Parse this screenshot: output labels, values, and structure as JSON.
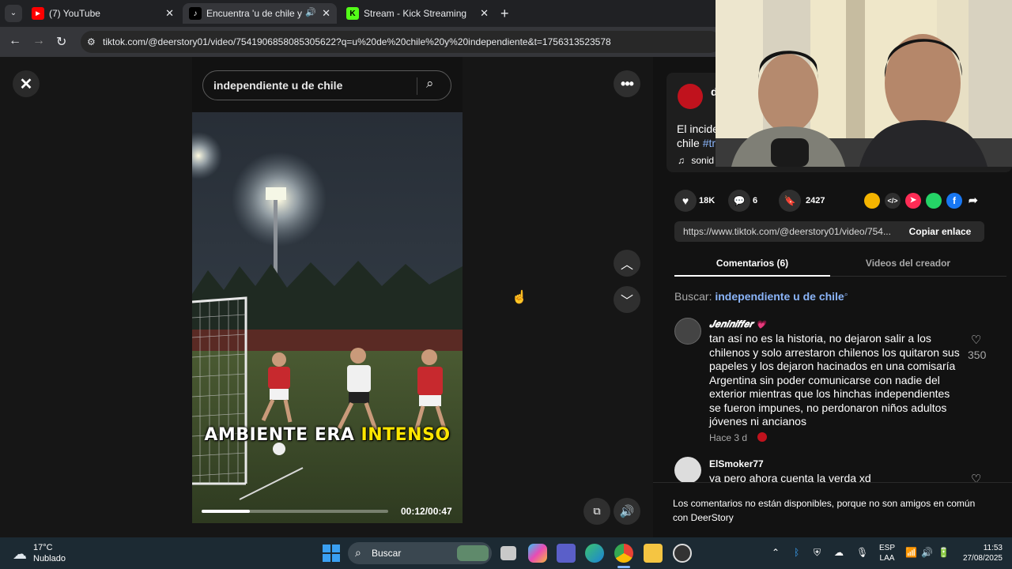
{
  "tabs": [
    {
      "label": "(7) YouTube",
      "icon": "youtube-icon",
      "active": false
    },
    {
      "label": "Encuentra 'u de chile y inde",
      "icon": "tiktok-icon",
      "active": true
    },
    {
      "label": "Stream - Kick Streaming",
      "icon": "kick-icon",
      "active": false
    }
  ],
  "address": {
    "url": "tiktok.com/@deerstory01/video/7541906858085305622?q=u%20de%20chile%20y%20independiente&t=1756313523578"
  },
  "search": {
    "value": "independiente u de chile"
  },
  "video": {
    "caption_white": "AMBIENTE ERA ",
    "caption_yellow": "INTENSO",
    "time": "00:12/00:47",
    "progress": 0.26
  },
  "post": {
    "author_initial": "d",
    "desc_line1": "El incide",
    "desc_line2_a": "chile ",
    "desc_line2_b": "#tr",
    "sound": "sonid"
  },
  "actions": {
    "likes": "18K",
    "comments": "6",
    "saves": "2427"
  },
  "share": {
    "link": "https://www.tiktok.com/@deerstory01/video/754...",
    "copy_label": "Copiar enlace"
  },
  "panel_tabs": {
    "comments": "Comentarios (6)",
    "creator": "Videos del creador"
  },
  "search_suggest": {
    "label": "Buscar:",
    "query": "independiente u de chile"
  },
  "comments": [
    {
      "user": "𝑱𝒆𝒏𝒊𝒏𝒊𝒇𝒇𝒆𝒓",
      "lines": [
        "tan así no es la historia, no dejaron salir a los",
        "chilenos y solo arrestaron chilenos los quitaron sus",
        "papeles y los dejaron hacinados en una comisaría",
        "Argentina sin poder comunicarse con nadie del",
        "exterior mientras que los hinchas independientes",
        "se fueron impunes, no perdonaron niños adultos",
        "jóvenes ni ancianos"
      ],
      "time": "Hace 3 d",
      "likes": "350"
    },
    {
      "user": "ElSmoker77",
      "lines": [
        "ya pero ahora cuenta la verda xd"
      ],
      "likes": ""
    }
  ],
  "notice": {
    "line1": "Los comentarios no están disponibles, porque no son amigos en común",
    "line2": "con DeerStory"
  },
  "taskbar": {
    "weather_temp": "17°C",
    "weather_desc": "Nublado",
    "search_placeholder": "Buscar",
    "lang_1": "ESP",
    "lang_2": "LAA",
    "time": "11:53",
    "date": "27/08/2025"
  },
  "colors": {
    "accent": "#fe2c55",
    "tiktok_link": "#8ab4f8",
    "caption_yellow": "#ffe600"
  }
}
